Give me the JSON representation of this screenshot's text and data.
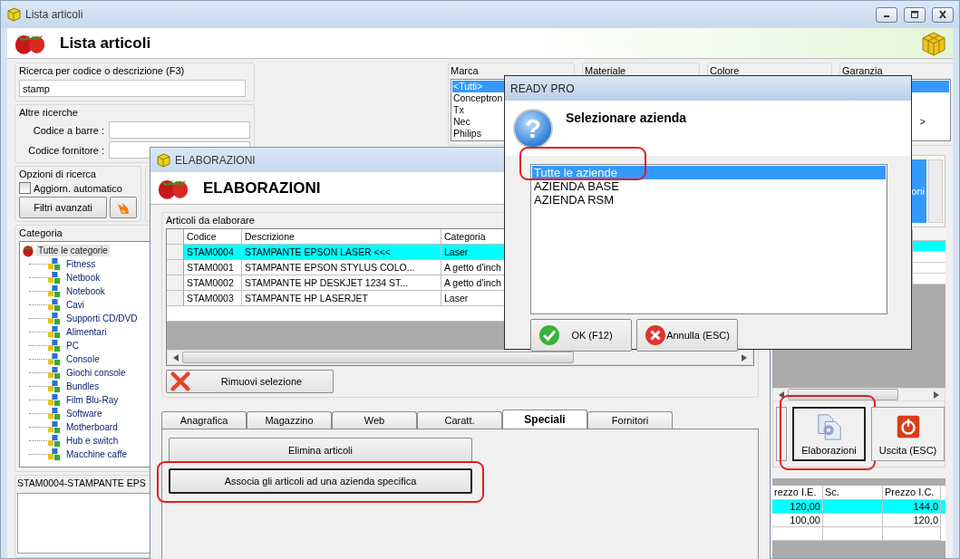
{
  "main_window": {
    "title": "Lista articoli",
    "header": "Lista articoli",
    "search": {
      "label": "Ricerca per codice o descrizione (F3)",
      "value": "stamp"
    },
    "other_searches": {
      "label": "Altre ricerche",
      "fields": [
        "Codice a barre :",
        "Codice fornitore :"
      ]
    },
    "search_options": {
      "label": "Opzioni di ricerca",
      "auto_update": {
        "label": "Aggiorn. automatico",
        "checked": false
      },
      "advanced_filters_button": "Filtri avanzati"
    },
    "category": {
      "label": "Categoria",
      "tree": {
        "label": "Tutte le categorie",
        "selected": true,
        "children": [
          {
            "label": "Fitness",
            "selected": false
          },
          {
            "label": "Netbook",
            "selected": false
          },
          {
            "label": "Notebook",
            "selected": false
          },
          {
            "label": "Cavi",
            "selected": false
          },
          {
            "label": "Supporti CD/DVD",
            "selected": false
          },
          {
            "label": "Alimentari",
            "selected": false
          },
          {
            "label": "PC",
            "selected": false
          },
          {
            "label": "Console",
            "selected": false
          },
          {
            "label": "Giochi console",
            "selected": false
          },
          {
            "label": "Bundles",
            "selected": false
          },
          {
            "label": "Film Blu-Ray",
            "selected": false
          },
          {
            "label": "Software",
            "selected": false
          },
          {
            "label": "Motherboard",
            "selected": false
          },
          {
            "label": "Hub e switch",
            "selected": false
          },
          {
            "label": "Macchine caffe",
            "selected": false
          }
        ]
      }
    },
    "detail": {
      "label": "STAM0004-STAMPANTE EPS"
    },
    "filters": [
      {
        "label": "Marca",
        "items": [
          {
            "label": "<Tutti>",
            "selected": true
          },
          {
            "label": "Conceptron",
            "selected": false
          },
          {
            "label": "Tx",
            "selected": false
          },
          {
            "label": "Nec",
            "selected": false
          },
          {
            "label": "Philips",
            "selected": false
          }
        ]
      },
      {
        "label": "Materiale"
      },
      {
        "label": "Colore"
      },
      {
        "label": "Garanzia",
        "items": [
          {
            "selected": true
          },
          {
            "selected": false
          },
          {
            "selected": false
          },
          {
            "label": ">",
            "selected": false
          }
        ]
      }
    ],
    "panel": {
      "header": "oni"
    },
    "grid": {
      "rows": [
        {
          "selected": true
        },
        {
          "selected": false
        },
        {
          "selected": false
        },
        {
          "selected": false
        }
      ]
    },
    "toolbar": [
      {
        "label": "Elaborazioni",
        "kind": "process",
        "highlighted": true
      },
      {
        "label": "Uscita (ESC)",
        "kind": "exit",
        "highlighted": false
      }
    ],
    "prices_table": {
      "columns": [
        "rezzo I.E.",
        "Sc.",
        "Prezzo I.C."
      ],
      "rows": [
        {
          "cells": [
            "120,00",
            null,
            "144,0"
          ],
          "selected": true
        },
        {
          "cells": [
            "100,00",
            null,
            "120,0"
          ],
          "selected": false
        }
      ]
    }
  },
  "elaborazioni_window": {
    "title": "ELABORAZIONI",
    "header": "ELABORAZIONI",
    "group": "Articoli da elaborare",
    "columns": [
      "Codice",
      "Descrizione",
      "Categoria"
    ],
    "rows": [
      {
        "cells": [
          "STAM0004",
          "STAMPANTE EPSON LASER <<<",
          "Laser"
        ],
        "selected": true
      },
      {
        "cells": [
          "STAM0001",
          "STAMPANTE EPSON STYLUS COLO...",
          "A getto d'inch"
        ],
        "selected": false
      },
      {
        "cells": [
          "STAM0002",
          "STAMPANTE HP DESKJET 1234 ST...",
          "A getto d'inch"
        ],
        "selected": false
      },
      {
        "cells": [
          "STAM0003",
          "STAMPANTE HP LASERJET",
          "Laser"
        ],
        "selected": false
      }
    ],
    "remove_button": "Rimuovi selezione",
    "tabs": [
      {
        "label": "Anagrafica",
        "selected": false
      },
      {
        "label": "Magazzino",
        "selected": false
      },
      {
        "label": "Web",
        "selected": false
      },
      {
        "label": "Caratt.",
        "selected": false
      },
      {
        "label": "Speciali",
        "selected": true
      },
      {
        "label": "Fornitori",
        "selected": false
      }
    ],
    "actions": [
      {
        "label": "Elimina articoli",
        "highlighted": false
      },
      {
        "label": "Associa gli articoli ad una azienda specifica",
        "highlighted": true
      }
    ]
  },
  "dialog": {
    "title": "READY PRO",
    "icon": "?",
    "message": "Selezionare azienda",
    "items": [
      {
        "label": "Tutte le aziende",
        "selected": true,
        "highlighted": true
      },
      {
        "label": "AZIENDA BASE",
        "selected": false,
        "highlighted": false
      },
      {
        "label": "AZIENDA RSM",
        "selected": false,
        "highlighted": false
      }
    ],
    "buttons": [
      {
        "label": "OK (F12)",
        "kind": "ok"
      },
      {
        "label": "Annulla (ESC)",
        "kind": "cancel"
      }
    ]
  }
}
